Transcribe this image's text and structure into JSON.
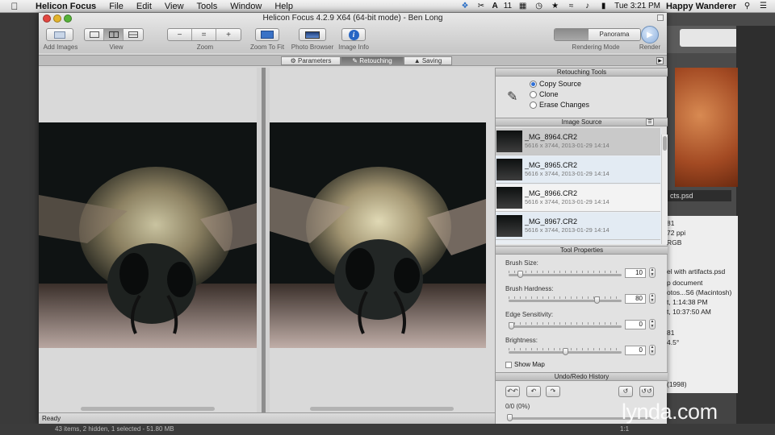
{
  "menubar": {
    "app_name": "Helicon Focus",
    "menus": [
      "File",
      "Edit",
      "View",
      "Tools",
      "Window",
      "Help"
    ],
    "status_badge": "11",
    "clock": "Tue 3:21 PM",
    "user": "Happy Wanderer"
  },
  "window": {
    "title": "Helicon Focus 4.2.9 X64 (64-bit mode) - Ben Long",
    "toolbar": {
      "add_images": "Add Images",
      "view": "View",
      "zoom": "Zoom",
      "zoom_to_fit": "Zoom To Fit",
      "photo_browser": "Photo Browser",
      "image_info": "Image Info",
      "rendering_mode": "Rendering Mode",
      "render": "Render",
      "panorama": "Panorama"
    },
    "tabs": [
      "Parameters",
      "Retouching",
      "Saving"
    ],
    "active_tab": "Retouching"
  },
  "retouching_tools": {
    "header": "Retouching Tools",
    "options": [
      "Copy Source",
      "Clone",
      "Erase Changes"
    ],
    "selected": "Copy Source"
  },
  "image_source": {
    "header": "Image Source",
    "items": [
      {
        "name": "_MG_8964.CR2",
        "meta": "5616 x 3744, 2013-01-29 14:14"
      },
      {
        "name": "_MG_8965.CR2",
        "meta": "5616 x 3744, 2013-01-29 14:14"
      },
      {
        "name": "_MG_8966.CR2",
        "meta": "5616 x 3744, 2013-01-29 14:14"
      },
      {
        "name": "_MG_8967.CR2",
        "meta": "5616 x 3744, 2013-01-29 14:14"
      }
    ]
  },
  "tool_properties": {
    "header": "Tool Properties",
    "brush_size_label": "Brush Size:",
    "brush_size": "10",
    "brush_size_frac": 0.08,
    "brush_hardness_label": "Brush Hardness:",
    "brush_hardness": "80",
    "brush_hardness_frac": 0.8,
    "edge_sensitivity_label": "Edge Sensitivity:",
    "edge_sensitivity": "0",
    "edge_sensitivity_frac": 0.0,
    "brightness_label": "Brightness:",
    "brightness": "0",
    "brightness_frac": 0.5,
    "show_map": "Show Map"
  },
  "undo_redo": {
    "header": "Undo/Redo History",
    "count": "0/0 (0%)"
  },
  "statusbar": {
    "text": "Ready"
  },
  "background_app": {
    "thumb_label": "cts.psd",
    "meta_lines": [
      "81",
      "72 ppi",
      "RGB",
      "el with artifacts.psd",
      "p document",
      "otos...S6 (Macintosh)",
      "t, 1:14:38 PM",
      "t, 10:37:50 AM",
      "81",
      "4.5°",
      "(1998)"
    ],
    "bottom_status": "43 items, 2 hidden, 1 selected - 51.80 MB",
    "zoom_partial": "1:1"
  },
  "watermark": "lynda.com"
}
